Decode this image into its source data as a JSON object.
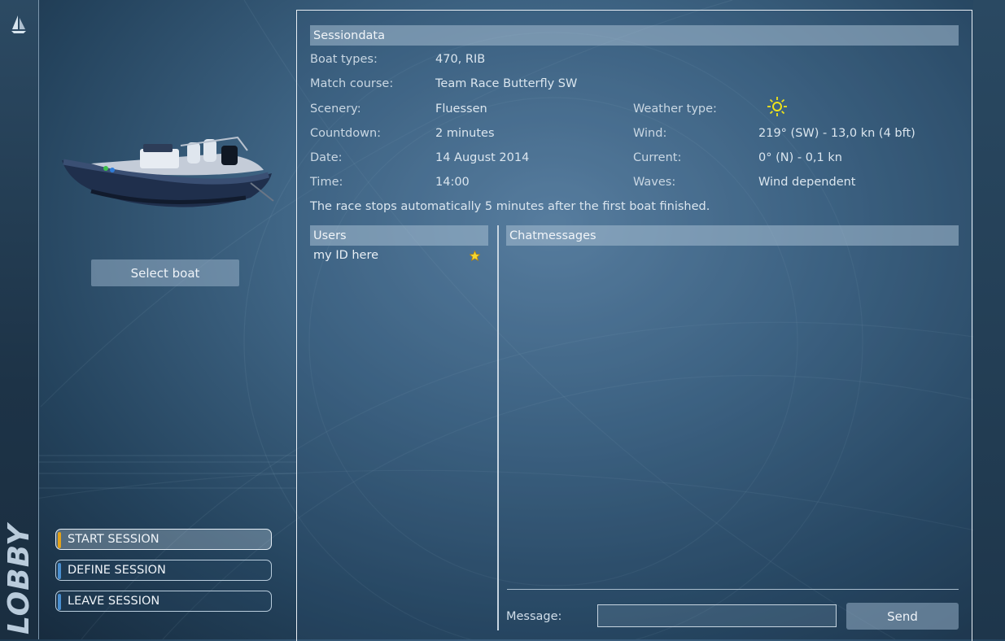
{
  "sidebar": {
    "logo_icon": "sailboat-icon",
    "title": "LOBBY"
  },
  "left_panel": {
    "boat_image": "rib-boat-image",
    "select_boat_label": "Select boat",
    "menu": [
      {
        "label": "START SESSION",
        "active": true
      },
      {
        "label": "DEFINE SESSION",
        "active": false
      },
      {
        "label": "LEAVE SESSION",
        "active": false
      }
    ]
  },
  "session": {
    "header": "Sessiondata",
    "boat_types_label": "Boat types:",
    "boat_types": "470, RIB",
    "match_course_label": "Match course:",
    "match_course": "Team Race Butterfly SW",
    "scenery_label": "Scenery:",
    "scenery": "Fluessen",
    "countdown_label": "Countdown:",
    "countdown": "2 minutes",
    "date_label": "Date:",
    "date": "14 August 2014",
    "time_label": "Time:",
    "time": "14:00",
    "weather_type_label": "Weather type:",
    "weather_icon": "sun-icon",
    "wind_label": "Wind:",
    "wind": "219° (SW) - 13,0 kn (4 bft)",
    "current_label": "Current:",
    "current": "0° (N) - 0,1 kn",
    "waves_label": "Waves:",
    "waves": "Wind dependent",
    "note": "The race stops automatically 5 minutes after the first boat finished."
  },
  "users": {
    "header": "Users",
    "items": [
      {
        "name": "my ID here",
        "icon": "star-icon"
      }
    ]
  },
  "chat": {
    "header": "Chatmessages",
    "message_label": "Message:",
    "message_value": "",
    "send_label": "Send"
  },
  "colors": {
    "accent_active": "#e2a21a",
    "accent_inactive": "#4a8fd0",
    "sun": "#f0e41a"
  }
}
